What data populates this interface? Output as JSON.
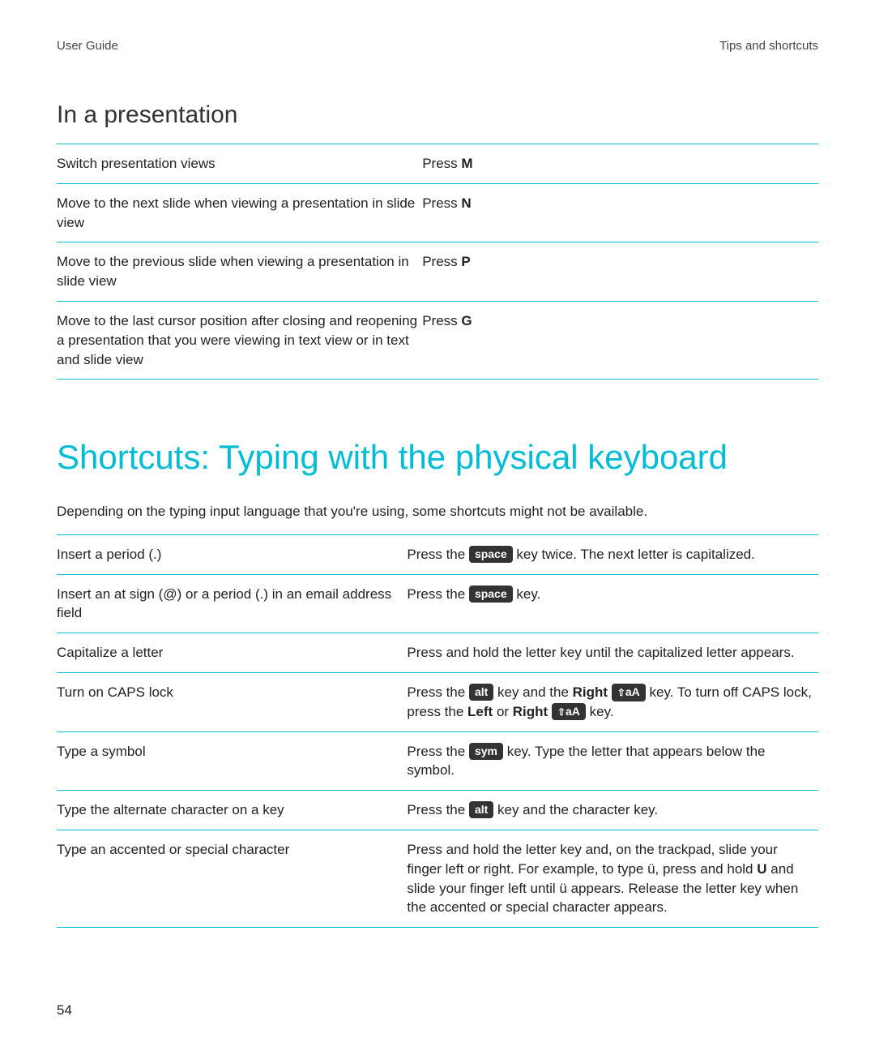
{
  "header": {
    "left": "User Guide",
    "right": "Tips and shortcuts"
  },
  "section1": {
    "heading": "In a presentation",
    "rows": [
      {
        "action": "Switch presentation views",
        "shortcut_prefix": "Press ",
        "shortcut_key": "M"
      },
      {
        "action": "Move to the next slide when viewing a presentation in slide view",
        "shortcut_prefix": "Press ",
        "shortcut_key": "N"
      },
      {
        "action": "Move to the previous slide when viewing a presentation in slide view",
        "shortcut_prefix": "Press ",
        "shortcut_key": "P"
      },
      {
        "action": "Move to the last cursor position after closing and reopening a presentation that you were viewing in text view or in text and slide view",
        "shortcut_prefix": "Press ",
        "shortcut_key": "G"
      }
    ]
  },
  "section2": {
    "heading": "Shortcuts: Typing with the physical keyboard",
    "intro": "Depending on the typing input language that you're using, some shortcuts might not be available.",
    "rows": [
      {
        "action": "Insert a period (.)",
        "segments": [
          {
            "t": "text",
            "v": "Press the "
          },
          {
            "t": "keycap",
            "v": "space"
          },
          {
            "t": "text",
            "v": " key twice. The next letter is capitalized."
          }
        ]
      },
      {
        "action": "Insert an at sign (@) or a period (.) in an email address field",
        "segments": [
          {
            "t": "text",
            "v": "Press the "
          },
          {
            "t": "keycap",
            "v": "space"
          },
          {
            "t": "text",
            "v": " key."
          }
        ]
      },
      {
        "action": "Capitalize a letter",
        "segments": [
          {
            "t": "text",
            "v": "Press and hold the letter key until the capitalized letter appears."
          }
        ]
      },
      {
        "action": "Turn on CAPS lock",
        "segments": [
          {
            "t": "text",
            "v": "Press the "
          },
          {
            "t": "keycap",
            "v": "alt"
          },
          {
            "t": "text",
            "v": " key and the "
          },
          {
            "t": "bold",
            "v": "Right"
          },
          {
            "t": "text",
            "v": " "
          },
          {
            "t": "shiftkey",
            "v": "aA"
          },
          {
            "t": "text",
            "v": " key. To turn off CAPS lock, press the "
          },
          {
            "t": "bold",
            "v": "Left"
          },
          {
            "t": "text",
            "v": " or "
          },
          {
            "t": "bold",
            "v": "Right"
          },
          {
            "t": "text",
            "v": " "
          },
          {
            "t": "shiftkey",
            "v": "aA"
          },
          {
            "t": "text",
            "v": " key."
          }
        ]
      },
      {
        "action": "Type a symbol",
        "segments": [
          {
            "t": "text",
            "v": "Press the "
          },
          {
            "t": "keycap",
            "v": "sym"
          },
          {
            "t": "text",
            "v": " key. Type the letter that appears below the symbol."
          }
        ]
      },
      {
        "action": "Type the alternate character on a key",
        "segments": [
          {
            "t": "text",
            "v": "Press the "
          },
          {
            "t": "keycap",
            "v": "alt"
          },
          {
            "t": "text",
            "v": " key and the character key."
          }
        ]
      },
      {
        "action": "Type an accented or special character",
        "segments": [
          {
            "t": "text",
            "v": "Press and hold the letter key and, on the trackpad, slide your finger left or right. For example, to type ü, press and hold "
          },
          {
            "t": "bold",
            "v": "U"
          },
          {
            "t": "text",
            "v": " and slide your finger left until ü appears. Release the letter key when the accented or special character appears."
          }
        ]
      }
    ]
  },
  "page_number": "54"
}
